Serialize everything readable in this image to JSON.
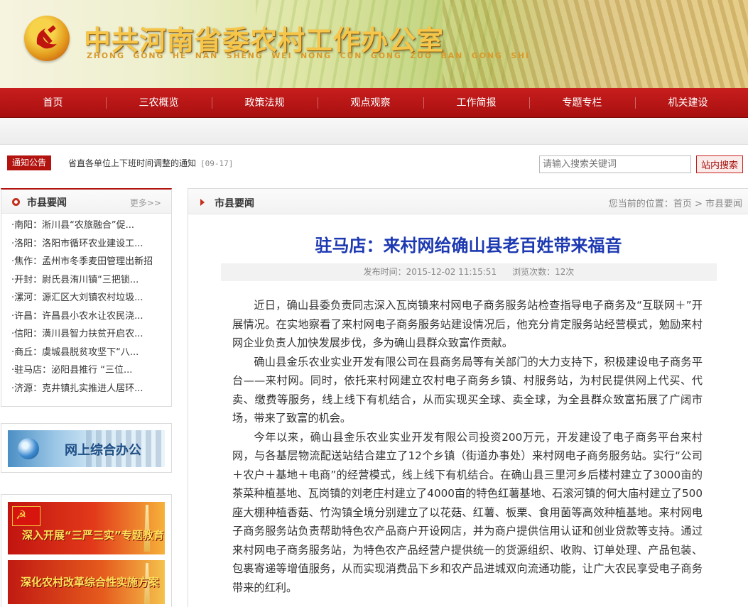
{
  "header": {
    "site_title": "中共河南省委农村工作办公室",
    "site_pinyin": "ZHONG GONG HE NAN SHENG WEI NONG CUN GONG ZUO BAN GONG SHI"
  },
  "nav": {
    "items": [
      "首页",
      "三农概览",
      "政策法规",
      "观点观察",
      "工作简报",
      "专题专栏",
      "机关建设"
    ]
  },
  "notice": {
    "label": "通知公告",
    "text": "省直各单位上下班时间调整的通知",
    "date": "[09-17]"
  },
  "search": {
    "placeholder": "请输入搜索关键词",
    "button": "站内搜索"
  },
  "sidebar": {
    "title": "市县要闻",
    "more": "更多>>",
    "items": [
      {
        "prefix": "·南阳：",
        "text": "淅川县“农旅融合”促..."
      },
      {
        "prefix": "·洛阳：",
        "text": "洛阳市循环农业建设工..."
      },
      {
        "prefix": "·焦作：",
        "text": "孟州市冬季麦田管理出新招"
      },
      {
        "prefix": "·开封：",
        "text": "尉氏县洧川镇“三把锁..."
      },
      {
        "prefix": "·漯河：",
        "text": "源汇区大刘镇农村垃圾..."
      },
      {
        "prefix": "·许昌：",
        "text": "许昌县小农水让农民浇..."
      },
      {
        "prefix": "·信阳：",
        "text": "潢川县智力扶贫开启农..."
      },
      {
        "prefix": "·商丘：",
        "text": "虞城县脱贫攻坚下“八..."
      },
      {
        "prefix": "·驻马店：",
        "text": "泌阳县推行 “三位..."
      },
      {
        "prefix": "·济源：",
        "text": "克井镇扎实推进人居环..."
      }
    ],
    "promo": "网上综合办公",
    "feature1": "深入开展“三严三实”专题教育",
    "feature2": "深化农村改革综合性实施方案"
  },
  "main": {
    "section_title": "市县要闻",
    "breadcrumb": {
      "prefix": "您当前的位置：",
      "home": "首页",
      "sep": " > ",
      "current": "市县要闻"
    },
    "article": {
      "title": "驻马店：来村网给确山县老百姓带来福音",
      "publish": "发布时间：2015-12-02 11:15:51",
      "views": "浏览次数：12次",
      "paragraphs": [
        "近日，确山县委负责同志深入瓦岗镇来村网电子商务服务站检查指导电子商务及“互联网＋”开展情况。在实地察看了来村网电子商务服务站建设情况后，他充分肯定服务站经营模式，勉励来村网企业负责人加快发展步伐，多为确山县群众致富作贡献。",
        "确山县金乐农业实业开发有限公司在县商务局等有关部门的大力支持下，积极建设电子商务平台——来村网。同时，依托来村网建立农村电子商务乡镇、村服务站，为村民提供网上代买、代卖、缴费等服务，线上线下有机结合，从而实现买全球、卖全球，为全县群众致富拓展了广阔市场，带来了致富的机会。",
        "今年以来，确山县金乐农业实业开发有限公司投资200万元，开发建设了电子商务平台来村网，与各基层物流配送站结合建立了12个乡镇（街道办事处）来村网电子商务服务站。实行“公司＋农户＋基地＋电商”的经营模式，线上线下有机结合。在确山县三里河乡后楼村建立了3000亩的茶菜种植基地、瓦岗镇的刘老庄村建立了4000亩的特色红薯基地、石滚河镇的何大庙村建立了500座大棚种植香菇、竹沟镇全境分别建立了以花菇、红薯、板栗、食用菌等高效种植基地。来村网电子商务服务站负责帮助特色农产品商户开设网店，并为商户提供信用认证和创业贷款等支持。通过来村网电子商务服务站，为特色农产品经营户提供统一的货源组织、收购、订单处理、产品包装、包裹寄递等增值服务，从而实现消费品下乡和农产品进城双向流通功能，让广大农民享受电子商务带来的红利。"
      ]
    }
  },
  "colors": {
    "nav_red": "#b3130f",
    "title_blue": "#1d39b2",
    "banner_gold": "#f5c64a"
  }
}
